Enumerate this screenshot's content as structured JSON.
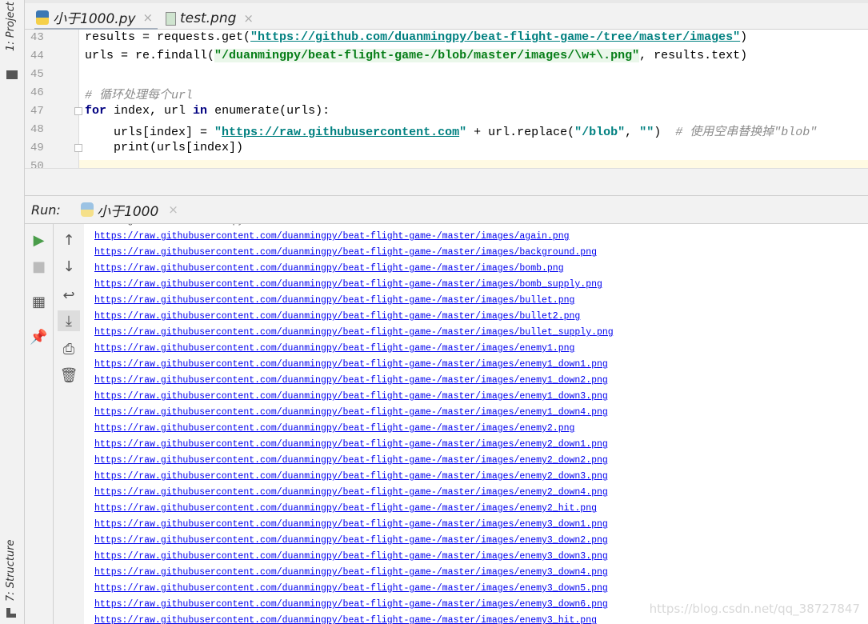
{
  "sidebar": {
    "project": "1: Project",
    "structure": "7: Structure"
  },
  "tabs": [
    {
      "label": "小于1000.py",
      "close": "×"
    },
    {
      "label": "test.png",
      "close": "×"
    }
  ],
  "editor": {
    "lines": [
      {
        "n": "43",
        "parts": [
          [
            "",
            "results = requests.get("
          ],
          [
            "str u",
            "\"https://github.com/duanmingpy/beat-flight-game-/tree/master/images\""
          ],
          [
            "",
            ")"
          ]
        ]
      },
      {
        "n": "44",
        "parts": [
          [
            "",
            "urls = re.findall("
          ],
          [
            "grn",
            "\"/duanmingpy/beat-flight-game-/blob/master/images/\\w+\\.png\""
          ],
          [
            "",
            ", results.text)"
          ]
        ]
      },
      {
        "n": "45",
        "parts": []
      },
      {
        "n": "46",
        "parts": [
          [
            "cm",
            "# 循环处理每个url"
          ]
        ]
      },
      {
        "n": "47",
        "parts": [
          [
            "kw",
            "for"
          ],
          [
            "",
            " index, url "
          ],
          [
            "kw",
            "in"
          ],
          [
            "",
            " enumerate(urls):"
          ]
        ]
      },
      {
        "n": "48",
        "parts": [
          [
            "",
            "    urls[index] = "
          ],
          [
            "str",
            "\""
          ],
          [
            "str u",
            "https://raw.githubusercontent.com"
          ],
          [
            "str",
            "\""
          ],
          [
            "",
            " + url.replace("
          ],
          [
            "str",
            "\"/blob\""
          ],
          [
            "",
            ", "
          ],
          [
            "str",
            "\"\""
          ],
          [
            "",
            ")  "
          ],
          [
            "cm",
            "# 使用空串替换掉\"blob\""
          ]
        ]
      },
      {
        "n": "49",
        "parts": [
          [
            "",
            "    print(urls[index])"
          ]
        ]
      },
      {
        "n": "50",
        "parts": []
      }
    ]
  },
  "run": {
    "label": "Run:",
    "tab": "小于1000",
    "close": "×"
  },
  "output": {
    "prefix": "https://raw.githubusercontent.com/duanmingpy/beat-flight-game-/master/images/",
    "files": [
      "again.png",
      "background.png",
      "bomb.png",
      "bomb_supply.png",
      "bullet.png",
      "bullet2.png",
      "bullet_supply.png",
      "enemy1.png",
      "enemy1_down1.png",
      "enemy1_down2.png",
      "enemy1_down3.png",
      "enemy1_down4.png",
      "enemy2.png",
      "enemy2_down1.png",
      "enemy2_down2.png",
      "enemy2_down3.png",
      "enemy2_down4.png",
      "enemy2_hit.png",
      "enemy3_down1.png",
      "enemy3_down2.png",
      "enemy3_down3.png",
      "enemy3_down4.png",
      "enemy3_down5.png",
      "enemy3_down6.png",
      "enemy3_hit.png"
    ]
  },
  "watermark": "https://blog.csdn.net/qq_38727847"
}
